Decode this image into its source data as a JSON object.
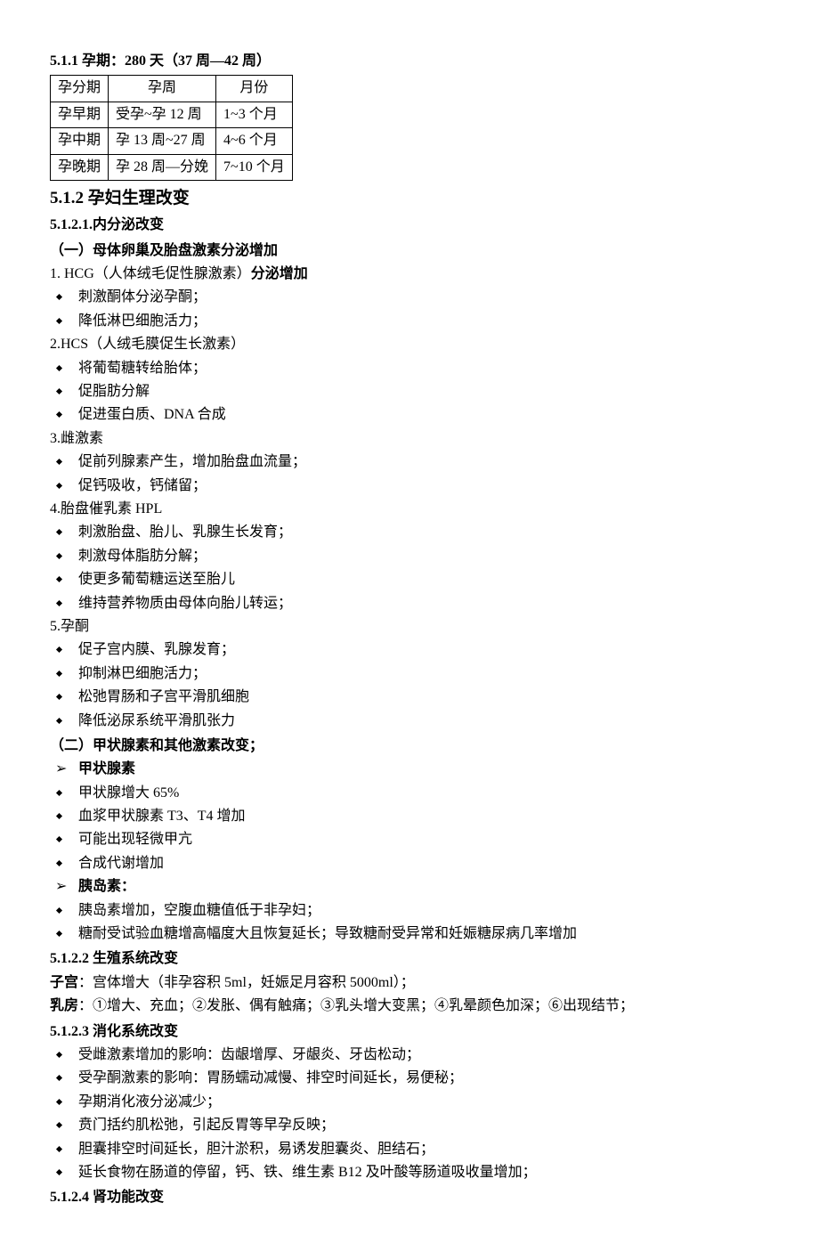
{
  "h511": "5.1.1 孕期：280 天（37 周—42 周）",
  "table": {
    "header": {
      "c1": "孕分期",
      "c2": "孕周",
      "c3": "月份"
    },
    "rows": [
      {
        "c1": "孕早期",
        "c2": "受孕~孕 12 周",
        "c3": "1~3 个月"
      },
      {
        "c1": "孕中期",
        "c2": "孕 13 周~27 周",
        "c3": "4~6 个月"
      },
      {
        "c1": "孕晚期",
        "c2": "孕 28 周—分娩",
        "c3": "7~10 个月"
      }
    ]
  },
  "h512": "5.1.2  孕妇生理改变",
  "h5121": "5.1.2.1.内分泌改变",
  "sec1": {
    "title": "（一）母体卵巢及胎盘激素分泌增加",
    "p1a": "1. HCG",
    "p1b": "（人体绒毛促性腺激素）",
    "p1c": "分泌增加",
    "l1": [
      "刺激酮体分泌孕酮；",
      "降低淋巴细胞活力；"
    ],
    "p2": "2.HCS（人绒毛膜促生长激素）",
    "l2": [
      "将葡萄糖转给胎体；",
      "促脂肪分解",
      "促进蛋白质、DNA 合成"
    ],
    "p3": "3.雌激素",
    "l3": [
      "促前列腺素产生，增加胎盘血流量；",
      "促钙吸收，钙储留；"
    ],
    "p4": "4.胎盘催乳素 HPL",
    "l4": [
      "刺激胎盘、胎儿、乳腺生长发育；",
      "刺激母体脂肪分解；",
      "使更多葡萄糖运送至胎儿",
      "维持营养物质由母体向胎儿转运；"
    ],
    "p5": "5.孕酮",
    "l5": [
      "促子宫内膜、乳腺发育；",
      "抑制淋巴细胞活力；",
      "松弛胃肠和子宫平滑肌细胞",
      "降低泌尿系统平滑肌张力"
    ]
  },
  "sec2": {
    "title": "（二）甲状腺素和其他激素改变；",
    "a1": "甲状腺素",
    "l1": [
      "甲状腺增大 65%",
      "血浆甲状腺素 T3、T4 增加",
      "可能出现轻微甲亢",
      "合成代谢增加"
    ],
    "a2": "胰岛素：",
    "l2": [
      "胰岛素增加，空腹血糖值低于非孕妇；",
      "糖耐受试验血糖增高幅度大且恢复延长；导致糖耐受异常和妊娠糖尿病几率增加"
    ]
  },
  "h5122": "5.1.2.2 生殖系统改变",
  "repro": {
    "p1a": "子宫",
    "p1b": "：宫体增大（非孕容积 5ml，妊娠足月容积 5000ml）；",
    "p2a": "乳房",
    "p2b": "：①增大、充血；②发胀、偶有触痛；③乳头增大变黑；④乳晕颜色加深；⑥出现结节；"
  },
  "h5123": "5.1.2.3 消化系统改变",
  "dig": [
    "受雌激素增加的影响：齿龈增厚、牙龈炎、牙齿松动；",
    "受孕酮激素的影响：胃肠蠕动减慢、排空时间延长，易便秘；",
    "孕期消化液分泌减少；",
    "贲门括约肌松弛，引起反胃等早孕反映；",
    "胆囊排空时间延长，胆汁淤积，易诱发胆囊炎、胆结石；",
    "延长食物在肠道的停留，钙、铁、维生素 B12 及叶酸等肠道吸收量增加；"
  ],
  "h5124": "5.1.2.4 肾功能改变"
}
